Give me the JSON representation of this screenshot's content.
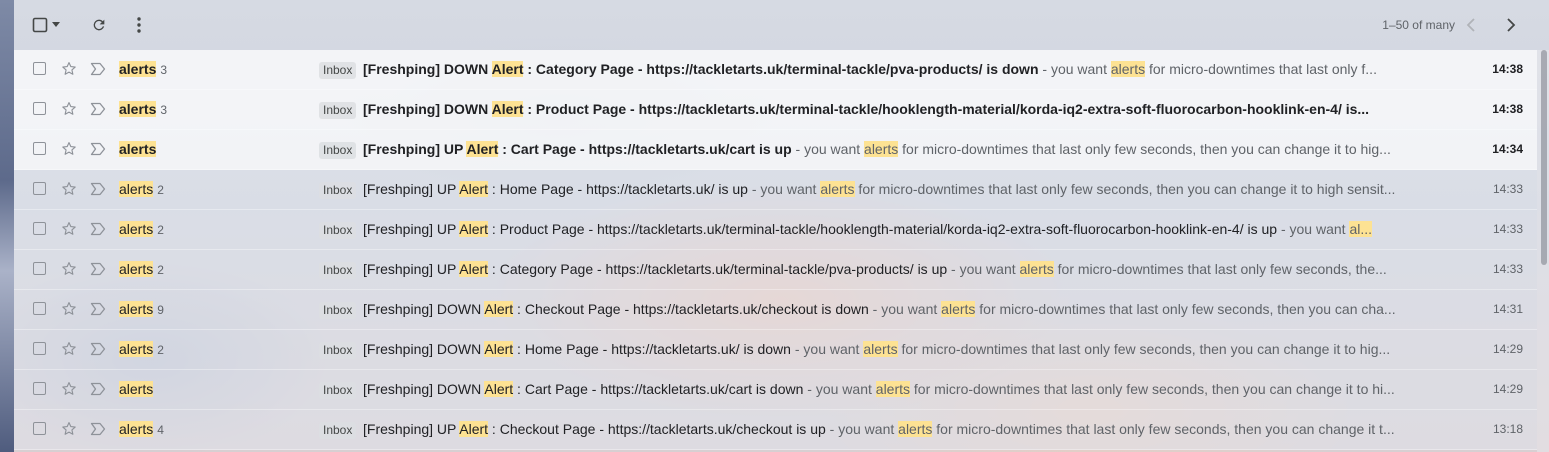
{
  "toolbar": {
    "select_icon": "checkbox-icon",
    "dropdown_icon": "caret-down-icon",
    "refresh_icon": "refresh-icon",
    "more_icon": "more-vert-icon",
    "pagination": "1–50 of many",
    "prev_icon": "chevron-left-icon",
    "next_icon": "chevron-right-icon"
  },
  "colors": {
    "highlight": "#fde293",
    "unread_bg": "#ffffff",
    "text_primary": "#202124",
    "text_secondary": "#5f6368"
  },
  "emails": [
    {
      "sender_hl": "alerts",
      "count": "3",
      "label": "Inbox",
      "unread": true,
      "subject_parts": [
        "[Freshping] DOWN ",
        "Alert",
        " : Category Page - https://tackletarts.uk/terminal-tackle/pva-products/ is down"
      ],
      "snippet_parts": [
        " - you want ",
        "alerts",
        " for micro-downtimes that last only f..."
      ],
      "time": "14:38"
    },
    {
      "sender_hl": "alerts",
      "count": "3",
      "label": "Inbox",
      "unread": true,
      "subject_parts": [
        "[Freshping] DOWN ",
        "Alert",
        " : Product Page - https://tackletarts.uk/terminal-tackle/hooklength-material/korda-iq2-extra-soft-fluorocarbon-hooklink-en-4/ is..."
      ],
      "snippet_parts": [
        "",
        "",
        ""
      ],
      "time": "14:38"
    },
    {
      "sender_hl": "alerts",
      "count": "",
      "label": "Inbox",
      "unread": true,
      "subject_parts": [
        "[Freshping] UP ",
        "Alert",
        " : Cart Page - https://tackletarts.uk/cart is up"
      ],
      "snippet_parts": [
        " - you want ",
        "alerts",
        " for micro-downtimes that last only few seconds, then you can change it to hig..."
      ],
      "time": "14:34"
    },
    {
      "sender_hl": "alerts",
      "count": "2",
      "label": "Inbox",
      "unread": false,
      "subject_parts": [
        "[Freshping] UP ",
        "Alert",
        " : Home Page - https://tackletarts.uk/ is up"
      ],
      "snippet_parts": [
        " - you want ",
        "alerts",
        " for micro-downtimes that last only few seconds, then you can change it to high sensit..."
      ],
      "time": "14:33"
    },
    {
      "sender_hl": "alerts",
      "count": "2",
      "label": "Inbox",
      "unread": false,
      "subject_parts": [
        "[Freshping] UP ",
        "Alert",
        " : Product Page - https://tackletarts.uk/terminal-tackle/hooklength-material/korda-iq2-extra-soft-fluorocarbon-hooklink-en-4/ is up"
      ],
      "snippet_parts": [
        " - you want ",
        "al...",
        ""
      ],
      "time": "14:33"
    },
    {
      "sender_hl": "alerts",
      "count": "2",
      "label": "Inbox",
      "unread": false,
      "subject_parts": [
        "[Freshping] UP ",
        "Alert",
        " : Category Page - https://tackletarts.uk/terminal-tackle/pva-products/ is up"
      ],
      "snippet_parts": [
        " - you want ",
        "alerts",
        " for micro-downtimes that last only few seconds, the..."
      ],
      "time": "14:33"
    },
    {
      "sender_hl": "alerts",
      "count": "9",
      "label": "Inbox",
      "unread": false,
      "subject_parts": [
        "[Freshping] DOWN ",
        "Alert",
        " : Checkout Page - https://tackletarts.uk/checkout is down"
      ],
      "snippet_parts": [
        " - you want ",
        "alerts",
        " for micro-downtimes that last only few seconds, then you can cha..."
      ],
      "time": "14:31"
    },
    {
      "sender_hl": "alerts",
      "count": "2",
      "label": "Inbox",
      "unread": false,
      "subject_parts": [
        "[Freshping] DOWN ",
        "Alert",
        " : Home Page - https://tackletarts.uk/ is down"
      ],
      "snippet_parts": [
        " - you want ",
        "alerts",
        " for micro-downtimes that last only few seconds, then you can change it to hig..."
      ],
      "time": "14:29"
    },
    {
      "sender_hl": "alerts",
      "count": "",
      "label": "Inbox",
      "unread": false,
      "subject_parts": [
        "[Freshping] DOWN ",
        "Alert",
        " : Cart Page - https://tackletarts.uk/cart is down"
      ],
      "snippet_parts": [
        " - you want ",
        "alerts",
        " for micro-downtimes that last only few seconds, then you can change it to hi..."
      ],
      "time": "14:29"
    },
    {
      "sender_hl": "alerts",
      "count": "4",
      "label": "Inbox",
      "unread": false,
      "subject_parts": [
        "[Freshping] UP ",
        "Alert",
        " : Checkout Page - https://tackletarts.uk/checkout is up"
      ],
      "snippet_parts": [
        " - you want ",
        "alerts",
        " for micro-downtimes that last only few seconds, then you can change it t..."
      ],
      "time": "13:18"
    }
  ]
}
